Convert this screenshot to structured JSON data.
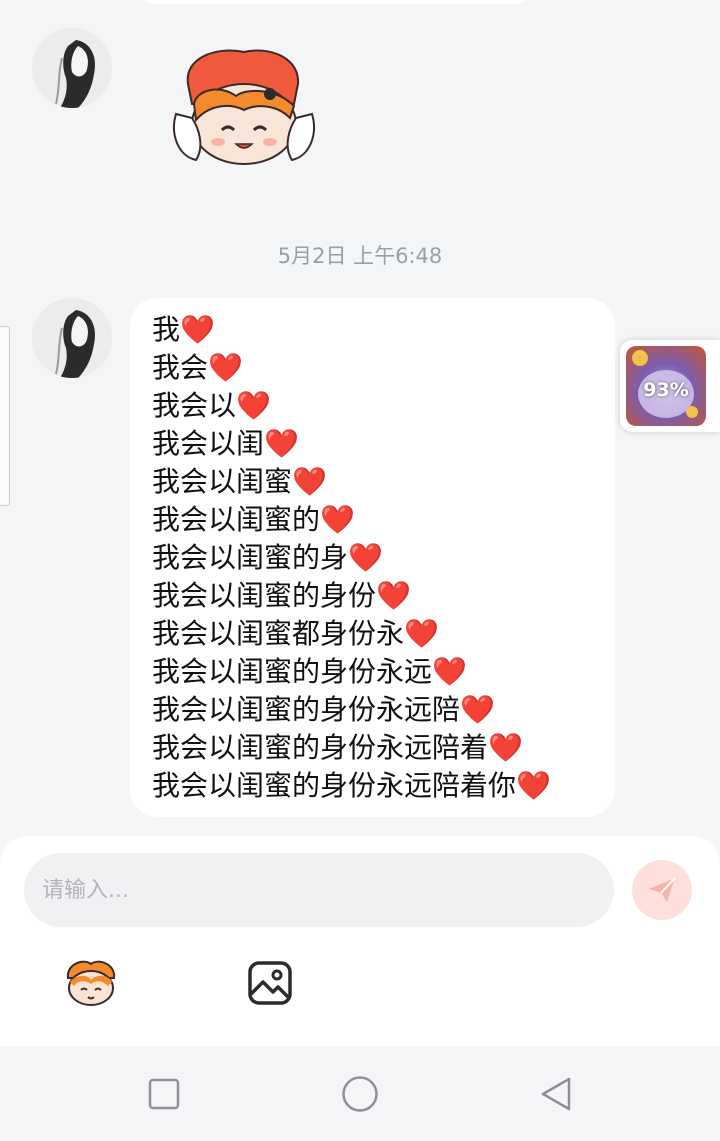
{
  "conversation": {
    "timestamp": "5月2日 上午6:48",
    "message_lines": [
      "我",
      "我会",
      "我会以",
      "我会以闺",
      "我会以闺蜜",
      "我会以闺蜜的",
      "我会以闺蜜的身",
      "我会以闺蜜的身份",
      "我会以闺蜜都身份永",
      "我会以闺蜜的身份永远",
      "我会以闺蜜的身份永远陪",
      "我会以闺蜜的身份永远陪着",
      "我会以闺蜜的身份永远陪着你"
    ],
    "heart_glyph": "❤️",
    "heart_color": "#e0262f"
  },
  "floating_widget": {
    "progress_label": "93%",
    "progress": 0.93
  },
  "composer": {
    "placeholder": "请输入...",
    "send_icon": "paper-plane-icon",
    "send_color": "#f26f5a",
    "tools": [
      "emoji-sticker-icon",
      "image-icon"
    ]
  },
  "nav": {
    "buttons": [
      "recent-apps-icon",
      "home-icon",
      "back-icon"
    ]
  }
}
